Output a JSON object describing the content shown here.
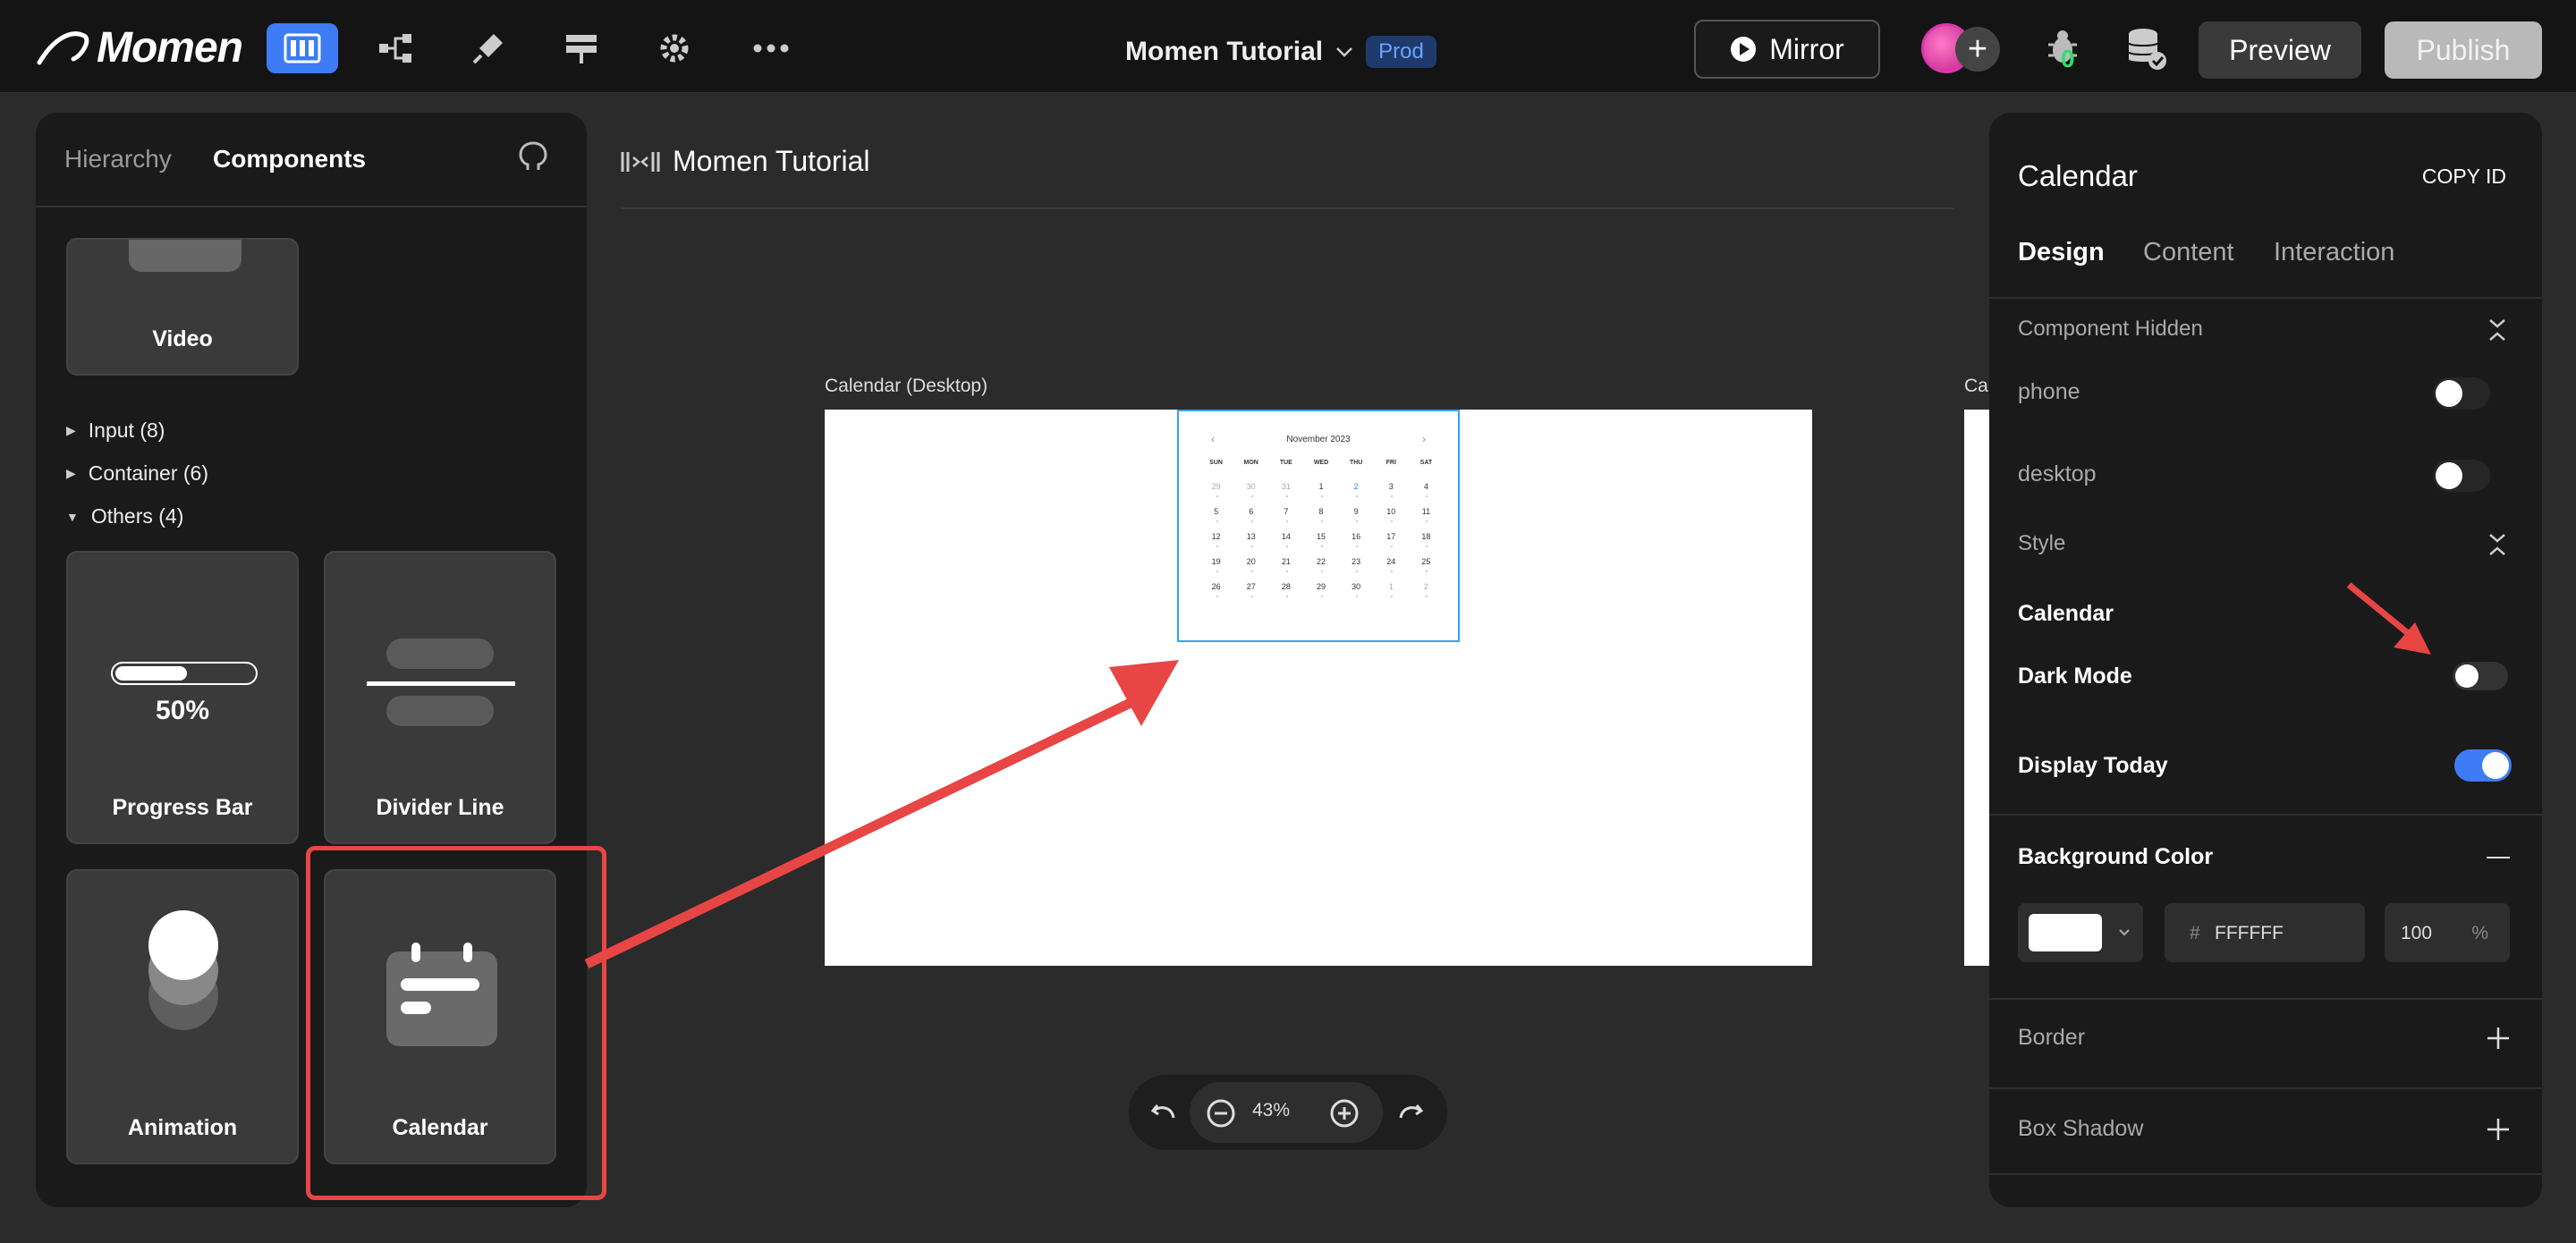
{
  "app": {
    "logo_text": "Momen",
    "project_name": "Momen Tutorial",
    "env_badge": "Prod",
    "mirror_label": "Mirror",
    "bug_count": "0",
    "preview_label": "Preview",
    "publish_label": "Publish"
  },
  "left_panel": {
    "tabs": [
      "Hierarchy",
      "Components"
    ],
    "active_tab": "Components",
    "video_card": "Video",
    "tree": [
      {
        "label": "Input (8)",
        "expanded": false
      },
      {
        "label": "Container (6)",
        "expanded": false
      },
      {
        "label": "Others (4)",
        "expanded": true
      }
    ],
    "cards": {
      "progress_bar": "Progress Bar",
      "progress_value": "50%",
      "divider_line": "Divider Line",
      "animation": "Animation",
      "calendar": "Calendar"
    }
  },
  "canvas": {
    "title": "Momen Tutorial",
    "frame_label": "Calendar (Desktop)",
    "frame2_label": "Cal",
    "zoom": "43%",
    "calendar": {
      "month": "November 2023",
      "prev": "‹",
      "next": "›",
      "weekdays": [
        "SUN",
        "MON",
        "TUE",
        "WED",
        "THU",
        "FRI",
        "SAT"
      ],
      "weeks": [
        [
          "29",
          "30",
          "31",
          "1",
          "2",
          "3",
          "4"
        ],
        [
          "5",
          "6",
          "7",
          "8",
          "9",
          "10",
          "11"
        ],
        [
          "12",
          "13",
          "14",
          "15",
          "16",
          "17",
          "18"
        ],
        [
          "19",
          "20",
          "21",
          "22",
          "23",
          "24",
          "25"
        ],
        [
          "26",
          "27",
          "28",
          "29",
          "30",
          "1",
          "2"
        ]
      ],
      "today": "2"
    }
  },
  "right_panel": {
    "title": "Calendar",
    "copy_id": "COPY ID",
    "tabs": [
      "Design",
      "Content",
      "Interaction"
    ],
    "active_tab": "Design",
    "component_hidden": "Component Hidden",
    "phone": "phone",
    "desktop": "desktop",
    "style": "Style",
    "calendar_section": "Calendar",
    "dark_mode": "Dark Mode",
    "dark_mode_on": false,
    "display_today": "Display Today",
    "display_today_on": true,
    "background_color": "Background Color",
    "hex_prefix": "#",
    "hex_value": "FFFFFF",
    "opacity": "100",
    "opacity_unit": "%",
    "border": "Border",
    "box_shadow": "Box Shadow"
  },
  "colors": {
    "accent": "#3d7cf5",
    "annotation": "#e84545",
    "bug_count": "#2ee06a"
  }
}
